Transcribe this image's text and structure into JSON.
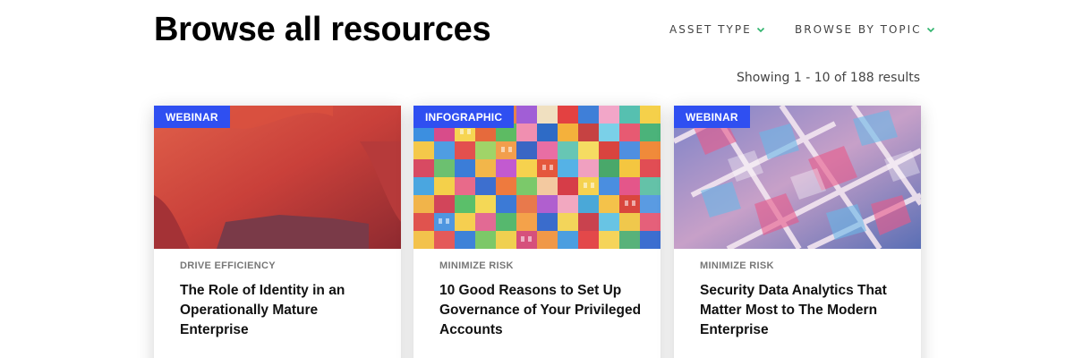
{
  "header": {
    "title": "Browse all resources"
  },
  "filters": {
    "asset_type": "ASSET TYPE",
    "browse_by_topic": "BROWSE BY TOPIC"
  },
  "results_text": "Showing 1 - 10 of 188 results",
  "colors": {
    "badge": "#2f4ff1",
    "chevron": "#2db36b"
  },
  "cards": [
    {
      "badge": "WEBINAR",
      "topic": "DRIVE EFFICIENCY",
      "title": "The Role of Identity in an Operationally Mature Enterprise"
    },
    {
      "badge": "INFOGRAPHIC",
      "topic": "MINIMIZE RISK",
      "title": "10 Good Reasons to Set Up Governance of Your Privileged Accounts"
    },
    {
      "badge": "WEBINAR",
      "topic": "MINIMIZE RISK",
      "title": "Security Data Analytics That Matter Most to The Modern Enterprise"
    }
  ]
}
